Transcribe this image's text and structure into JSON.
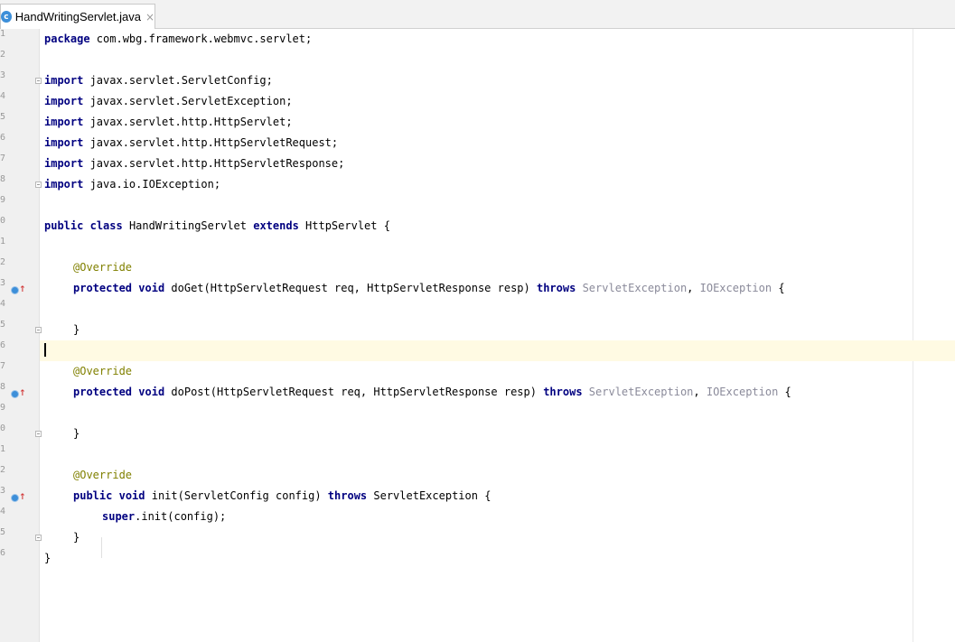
{
  "tab": {
    "icon_letter": "c",
    "title": "HandWritingServlet.java",
    "close_glyph": "×"
  },
  "gutter": {
    "line_numbers": [
      "1",
      "2",
      "3",
      "4",
      "5",
      "6",
      "7",
      "8",
      "9",
      "0",
      "1",
      "2",
      "3",
      "4",
      "5",
      "6",
      "7",
      "8",
      "9",
      "0",
      "1",
      "2",
      "3",
      "4",
      "5",
      "6"
    ]
  },
  "code": {
    "line01": {
      "kw1": "package",
      "rest": " com.wbg.framework.webmvc.servlet;"
    },
    "line03": {
      "kw1": "import",
      "rest": " javax.servlet.ServletConfig;"
    },
    "line04": {
      "kw1": "import",
      "rest": " javax.servlet.ServletException;"
    },
    "line05": {
      "kw1": "import",
      "rest": " javax.servlet.http.HttpServlet;"
    },
    "line06": {
      "kw1": "import",
      "rest": " javax.servlet.http.HttpServletRequest;"
    },
    "line07": {
      "kw1": "import",
      "rest": " javax.servlet.http.HttpServletResponse;"
    },
    "line08": {
      "kw1": "import",
      "rest": " java.io.IOException;"
    },
    "line10": {
      "kw1": "public",
      "sp1": " ",
      "kw2": "class",
      "name": " HandWritingServlet ",
      "kw3": "extends",
      "rest": " HttpServlet {"
    },
    "line12": {
      "ann": "@Override"
    },
    "line13": {
      "kw1": "protected",
      "sp1": " ",
      "kw2": "void",
      "sig": " doGet(HttpServletRequest req, HttpServletResponse resp) ",
      "kw3": "throws",
      "sp2": " ",
      "ex1": "ServletException",
      "comma": ", ",
      "ex2": "IOException",
      "tail": " {"
    },
    "line15": {
      "brace": "}"
    },
    "line17": {
      "ann": "@Override"
    },
    "line18": {
      "kw1": "protected",
      "sp1": " ",
      "kw2": "void",
      "sig": " doPost(HttpServletRequest req, HttpServletResponse resp) ",
      "kw3": "throws",
      "sp2": " ",
      "ex1": "ServletException",
      "comma": ", ",
      "ex2": "IOException",
      "tail": " {"
    },
    "line20": {
      "brace": "}"
    },
    "line22": {
      "ann": "@Override"
    },
    "line23": {
      "kw1": "public",
      "sp1": " ",
      "kw2": "void",
      "sig": " init(ServletConfig config) ",
      "kw3": "throws",
      "rest": " ServletException {"
    },
    "line24": {
      "kw1": "super",
      "rest": ".init(config);"
    },
    "line25": {
      "brace": "}"
    },
    "line26": {
      "brace": "}"
    }
  },
  "colors": {
    "keyword": "#000080",
    "annotation": "#808000",
    "unused_exception": "#8a8a9a",
    "current_line": "#fffae3"
  }
}
